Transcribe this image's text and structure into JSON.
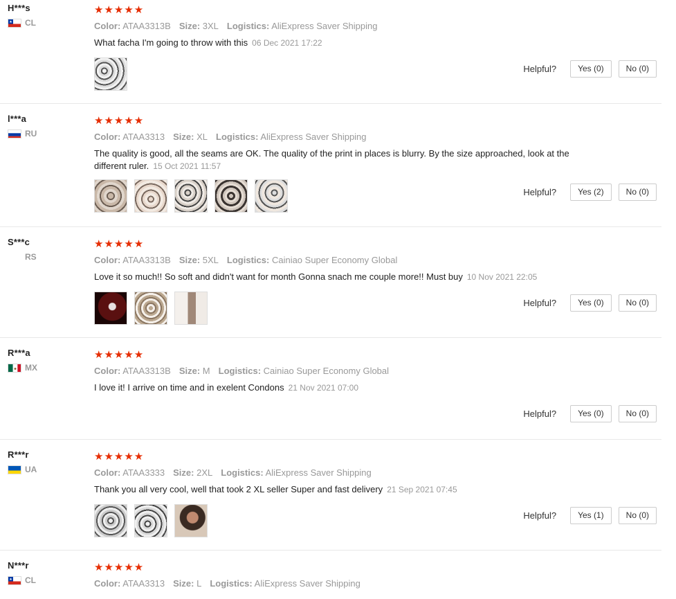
{
  "helpful_label": "Helpful?",
  "reviews": [
    {
      "user": "H***s",
      "country": "CL",
      "stars": "★★★★★",
      "color_label": "Color:",
      "color": "ATAA3313B",
      "size_label": "Size:",
      "size": "3XL",
      "logistics_label": "Logistics:",
      "logistics": "AliExpress Saver Shipping",
      "text": "What facha I'm going to throw with this",
      "date": "06 Dec 2021 17:22",
      "yes": "Yes (0)",
      "no": "No (0)"
    },
    {
      "user": "l***a",
      "country": "RU",
      "stars": "★★★★★",
      "color_label": "Color:",
      "color": "ATAA3313",
      "size_label": "Size:",
      "size": "XL",
      "logistics_label": "Logistics:",
      "logistics": "AliExpress Saver Shipping",
      "text": "The quality is good, all the seams are OK. The quality of the print in places is blurry. By the size approached, look at the different ruler.",
      "date": "15 Oct 2021 11:57",
      "yes": "Yes (2)",
      "no": "No (0)"
    },
    {
      "user": "S***c",
      "country": "RS",
      "stars": "★★★★★",
      "color_label": "Color:",
      "color": "ATAA3313B",
      "size_label": "Size:",
      "size": "5XL",
      "logistics_label": "Logistics:",
      "logistics": "Cainiao Super Economy Global",
      "text": "Love it so much!! So soft and didn't want for month Gonna snach me couple more!! Must buy",
      "date": "10 Nov 2021 22:05",
      "yes": "Yes (0)",
      "no": "No (0)"
    },
    {
      "user": "R***a",
      "country": "MX",
      "stars": "★★★★★",
      "color_label": "Color:",
      "color": "ATAA3313B",
      "size_label": "Size:",
      "size": "M",
      "logistics_label": "Logistics:",
      "logistics": "Cainiao Super Economy Global",
      "text": "I love it! I arrive on time and in exelent Condons",
      "date": "21 Nov 2021 07:00",
      "yes": "Yes (0)",
      "no": "No (0)"
    },
    {
      "user": "R***r",
      "country": "UA",
      "stars": "★★★★★",
      "color_label": "Color:",
      "color": "ATAA3333",
      "size_label": "Size:",
      "size": "2XL",
      "logistics_label": "Logistics:",
      "logistics": "AliExpress Saver Shipping",
      "text": "Thank you all very cool, well that took 2 XL seller Super and fast delivery",
      "date": "21 Sep 2021 07:45",
      "yes": "Yes (1)",
      "no": "No (0)"
    },
    {
      "user": "N***r",
      "country": "CL",
      "stars": "★★★★★",
      "color_label": "Color:",
      "color": "ATAA3313",
      "size_label": "Size:",
      "size": "L",
      "logistics_label": "Logistics:",
      "logistics": "AliExpress Saver Shipping"
    }
  ]
}
